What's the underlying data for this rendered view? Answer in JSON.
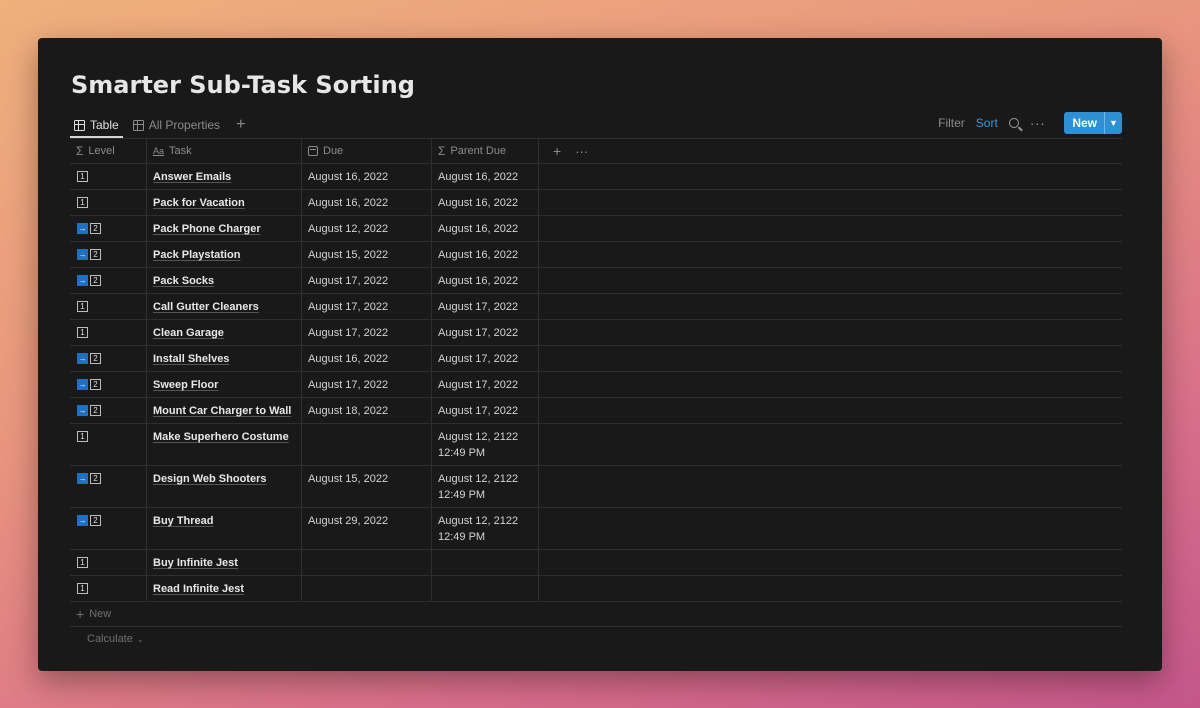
{
  "page": {
    "title": "Smarter Sub-Task Sorting"
  },
  "views": [
    {
      "label": "Table",
      "active": true
    },
    {
      "label": "All Properties",
      "active": false
    }
  ],
  "toolbar": {
    "filter": "Filter",
    "sort": "Sort",
    "new": "New",
    "accent": "#2e8fd4"
  },
  "columns": {
    "level": "Level",
    "task": "Task",
    "due": "Due",
    "parent_due": "Parent Due"
  },
  "rows": [
    {
      "level": "1",
      "sub": false,
      "task": "Answer Emails",
      "due": "August 16, 2022",
      "parent_due": [
        "August 16, 2022"
      ]
    },
    {
      "level": "1",
      "sub": false,
      "task": "Pack for Vacation",
      "due": "August 16, 2022",
      "parent_due": [
        "August 16, 2022"
      ]
    },
    {
      "level": "2",
      "sub": true,
      "task": "Pack Phone Charger",
      "due": "August 12, 2022",
      "parent_due": [
        "August 16, 2022"
      ]
    },
    {
      "level": "2",
      "sub": true,
      "task": "Pack Playstation",
      "due": "August 15, 2022",
      "parent_due": [
        "August 16, 2022"
      ]
    },
    {
      "level": "2",
      "sub": true,
      "task": "Pack Socks",
      "due": "August 17, 2022",
      "parent_due": [
        "August 16, 2022"
      ]
    },
    {
      "level": "1",
      "sub": false,
      "task": "Call Gutter Cleaners",
      "due": "August 17, 2022",
      "parent_due": [
        "August 17, 2022"
      ]
    },
    {
      "level": "1",
      "sub": false,
      "task": "Clean Garage",
      "due": "August 17, 2022",
      "parent_due": [
        "August 17, 2022"
      ]
    },
    {
      "level": "2",
      "sub": true,
      "task": "Install Shelves",
      "due": "August 16, 2022",
      "parent_due": [
        "August 17, 2022"
      ]
    },
    {
      "level": "2",
      "sub": true,
      "task": "Sweep Floor",
      "due": "August 17, 2022",
      "parent_due": [
        "August 17, 2022"
      ]
    },
    {
      "level": "2",
      "sub": true,
      "task": "Mount Car Charger to Wall",
      "due": "August 18, 2022",
      "parent_due": [
        "August 17, 2022"
      ]
    },
    {
      "level": "1",
      "sub": false,
      "task": "Make Superhero Costume",
      "due": "",
      "parent_due": [
        "August 12, 2122",
        "12:49 PM"
      ]
    },
    {
      "level": "2",
      "sub": true,
      "task": "Design Web Shooters",
      "due": "August 15, 2022",
      "parent_due": [
        "August 12, 2122",
        "12:49 PM"
      ]
    },
    {
      "level": "2",
      "sub": true,
      "task": "Buy Thread",
      "due": "August 29, 2022",
      "parent_due": [
        "August 12, 2122",
        "12:49 PM"
      ]
    },
    {
      "level": "1",
      "sub": false,
      "task": "Buy Infinite Jest",
      "due": "",
      "parent_due": []
    },
    {
      "level": "1",
      "sub": false,
      "task": "Read Infinite Jest",
      "due": "",
      "parent_due": []
    }
  ],
  "footer": {
    "new_row": "New",
    "calculate": "Calculate"
  }
}
